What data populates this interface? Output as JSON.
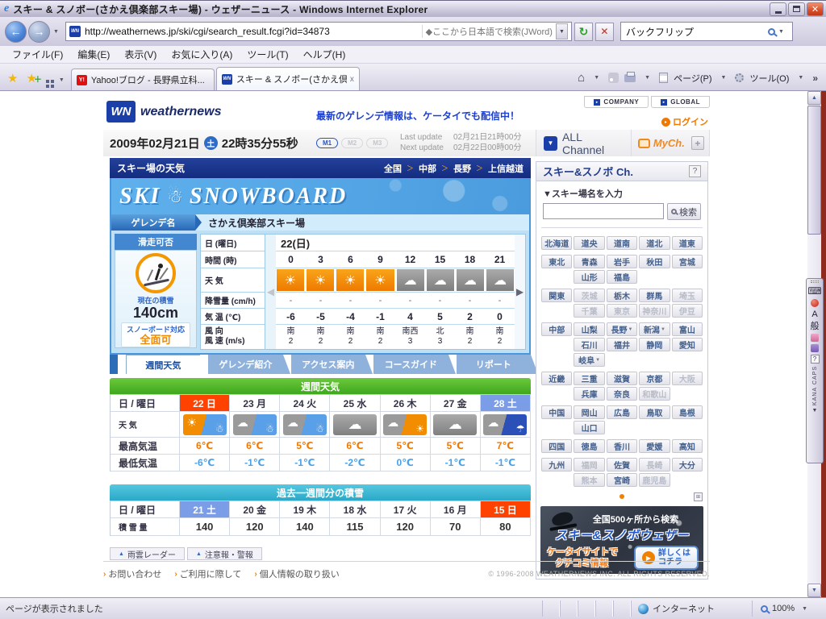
{
  "colors": {
    "accent_orange": "#F08A00",
    "accent_blue": "#2E6CC8",
    "navy": "#16309C",
    "holiday_red": "#FF4200",
    "saturday_blue": "#7B9DE8",
    "weekly_green": "#4FB82E",
    "past_cyan": "#3CB8DC"
  },
  "browser": {
    "title": "スキー & スノボー(さかえ倶楽部スキー場) - ウェザーニュース - Windows Internet Explorer",
    "url": "http://weathernews.jp/ski/cgi/search_result.fcgi?id=34873",
    "jword": "◆ここから日本語で検索(JWord)",
    "search_value": "バックフリップ",
    "menus": [
      "ファイル(F)",
      "編集(E)",
      "表示(V)",
      "お気に入り(A)",
      "ツール(T)",
      "ヘルプ(H)"
    ],
    "tabs": [
      {
        "label": "Yahoo!ブログ - 長野県立科...",
        "icon": "Y!"
      },
      {
        "label": "スキー & スノボー(さかえ倶...",
        "icon": "wn",
        "close": "x"
      }
    ],
    "command_bar": {
      "page": "ページ(P)",
      "tools": "ツール(O)",
      "overflow": "»"
    },
    "status": {
      "text": "ページが表示されました",
      "zone": "インターネット",
      "zoom": "100%"
    }
  },
  "header": {
    "logo_mark": "WN",
    "brand": "weathernews",
    "promo": "最新のゲレンデ情報は、ケータイでも配信中！",
    "company": "COMPANY",
    "global_label": "GLOBAL",
    "login": "ログイン",
    "date": "2009年02月21日",
    "dow": "土",
    "time": "22時35分55秒",
    "m_badges": [
      "M1",
      "M2",
      "M3"
    ],
    "last_update_label": "Last update",
    "last_update": "02月21日21時00分",
    "next_update_label": "Next update",
    "next_update": "02月22日00時00分",
    "all_channel": "ALL Channel",
    "mych": "MyCh.",
    "add_channel": "+"
  },
  "page": {
    "section_title": "スキー場の天気",
    "breadcrumb": [
      "全国",
      "中部",
      "長野",
      "上信越道"
    ],
    "breadcrumb_separator": "＞",
    "banner": {
      "ski": "SKI",
      "snowman": "☃",
      "snowboard": "SNOWBOARD"
    },
    "gelande_label": "ゲレンデ名",
    "gelande_name": "さかえ倶楽部スキー場",
    "status_card": {
      "title": "滑走可否",
      "snow_label": "現在の積雪",
      "snow_value": "140cm",
      "board_label": "スノーボード対応",
      "board_value": "全面可"
    },
    "icon_glyphs": {
      "sun": "☀",
      "cloud": "☁",
      "snow": "☃",
      "rain": "☂"
    },
    "hourly": {
      "date": "22(日)",
      "labels": {
        "day": "日 (曜日)",
        "hour": "時間 (時)",
        "weather": "天 気",
        "snowfall": "降雪量 (cm/h)",
        "temp": "気 温 (℃)",
        "wind_dir": "風 向",
        "wind_speed": "風 速 (m/s)"
      },
      "hours": [
        "0",
        "3",
        "6",
        "9",
        "12",
        "15",
        "18",
        "21"
      ],
      "icons": [
        "sun",
        "sun",
        "sun",
        "sun",
        "cloud",
        "cloud",
        "cloud",
        "cloud"
      ],
      "snowfall": [
        "-",
        "-",
        "-",
        "-",
        "-",
        "-",
        "-",
        "-"
      ],
      "temps": [
        "-6",
        "-5",
        "-4",
        "-1",
        "4",
        "5",
        "2",
        "0"
      ],
      "wind_dir": [
        "南",
        "南",
        "南",
        "南",
        "南西",
        "北",
        "南",
        "南"
      ],
      "wind_speed": [
        "2",
        "2",
        "2",
        "2",
        "3",
        "3",
        "2",
        "2"
      ]
    },
    "tabs": [
      "週間天気",
      "ゲレンデ紹介",
      "アクセス案内",
      "コースガイド",
      "リポート"
    ],
    "weekly": {
      "title": "週間天気",
      "labels": {
        "day": "日 / 曜日",
        "weather": "天 気",
        "high": "最高気温",
        "low": "最低気温"
      },
      "days": [
        {
          "label": "22 日",
          "style": "holiday"
        },
        {
          "label": "23 月"
        },
        {
          "label": "24 火"
        },
        {
          "label": "25 水"
        },
        {
          "label": "26 木"
        },
        {
          "label": "27 金"
        },
        {
          "label": "28 土",
          "style": "saturday"
        }
      ],
      "icons": [
        "sun-snow",
        "cloud-snow",
        "cloud-snow",
        "cloud",
        "cloud-sun",
        "cloud",
        "cloud-rain"
      ],
      "highs": [
        "6℃",
        "6℃",
        "5℃",
        "6℃",
        "5℃",
        "5℃",
        "7℃"
      ],
      "lows": [
        "-6℃",
        "-1℃",
        "-1℃",
        "-2℃",
        "0℃",
        "-1℃",
        "-1℃"
      ]
    },
    "past_week": {
      "title": "過去一週間分の積雪",
      "labels": {
        "day": "日 / 曜日",
        "amount": "積 雪 量"
      },
      "days": [
        {
          "label": "21 土",
          "style": "saturday"
        },
        {
          "label": "20 金"
        },
        {
          "label": "19 木"
        },
        {
          "label": "18 水"
        },
        {
          "label": "17 火"
        },
        {
          "label": "16 月"
        },
        {
          "label": "15 日",
          "style": "holiday"
        }
      ],
      "amounts": [
        "140",
        "120",
        "140",
        "115",
        "120",
        "70",
        "80"
      ]
    },
    "bottom_buttons": [
      "雨雲レーダー",
      "注意報・警報"
    ],
    "footer": {
      "link_bullet": "›",
      "links": [
        "お問い合わせ",
        "ご利用に際して",
        "個人情報の取り扱い"
      ],
      "copyright": "© 1996-2008 WEATHERNEWS INC. ALL RIGHTS RESERVED."
    }
  },
  "sidebar": {
    "title": "スキー&スノボ Ch.",
    "help": "?",
    "search_label": "▼スキー場名を入力",
    "search_button": "検索",
    "search_value": "",
    "regions": [
      {
        "gap": false,
        "cells": [
          {
            "t": "北海道"
          },
          {
            "t": "道央"
          },
          {
            "t": "道南"
          },
          {
            "t": "道北"
          },
          {
            "t": "道東"
          }
        ]
      },
      {
        "gap": true,
        "cells": [
          {
            "t": "東北"
          },
          {
            "t": "青森"
          },
          {
            "t": "岩手"
          },
          {
            "t": "秋田"
          },
          {
            "t": "宮城"
          }
        ]
      },
      {
        "gap": false,
        "cells": [
          {
            "s": "e"
          },
          {
            "t": "山形"
          },
          {
            "t": "福島"
          },
          {
            "s": "e"
          },
          {
            "s": "e"
          }
        ]
      },
      {
        "gap": true,
        "cells": [
          {
            "t": "関東"
          },
          {
            "t": "茨城",
            "s": "d"
          },
          {
            "t": "栃木"
          },
          {
            "t": "群馬"
          },
          {
            "t": "埼玉",
            "s": "d"
          }
        ]
      },
      {
        "gap": false,
        "cells": [
          {
            "s": "e"
          },
          {
            "t": "千葉",
            "s": "d"
          },
          {
            "t": "東京",
            "s": "d"
          },
          {
            "t": "神奈川",
            "s": "d"
          },
          {
            "t": "伊豆",
            "s": "d"
          }
        ]
      },
      {
        "gap": true,
        "cells": [
          {
            "t": "中部"
          },
          {
            "t": "山梨"
          },
          {
            "t": "長野",
            "a": true
          },
          {
            "t": "新潟",
            "a": true
          },
          {
            "t": "富山"
          }
        ]
      },
      {
        "gap": false,
        "cells": [
          {
            "s": "e"
          },
          {
            "t": "石川"
          },
          {
            "t": "福井"
          },
          {
            "t": "静岡"
          },
          {
            "t": "愛知"
          }
        ]
      },
      {
        "gap": false,
        "cells": [
          {
            "s": "e"
          },
          {
            "t": "岐阜",
            "a": true
          },
          {
            "s": "e"
          },
          {
            "s": "e"
          },
          {
            "s": "e"
          }
        ]
      },
      {
        "gap": true,
        "cells": [
          {
            "t": "近畿"
          },
          {
            "t": "三重"
          },
          {
            "t": "滋賀"
          },
          {
            "t": "京都"
          },
          {
            "t": "大阪",
            "s": "d"
          }
        ]
      },
      {
        "gap": false,
        "cells": [
          {
            "s": "e"
          },
          {
            "t": "兵庫"
          },
          {
            "t": "奈良"
          },
          {
            "t": "和歌山",
            "s": "d"
          },
          {
            "s": "e"
          }
        ]
      },
      {
        "gap": true,
        "cells": [
          {
            "t": "中国"
          },
          {
            "t": "岡山"
          },
          {
            "t": "広島"
          },
          {
            "t": "鳥取"
          },
          {
            "t": "島根"
          }
        ]
      },
      {
        "gap": false,
        "cells": [
          {
            "s": "e"
          },
          {
            "t": "山口"
          },
          {
            "s": "e"
          },
          {
            "s": "e"
          },
          {
            "s": "e"
          }
        ]
      },
      {
        "gap": true,
        "cells": [
          {
            "t": "四国"
          },
          {
            "t": "徳島"
          },
          {
            "t": "香川"
          },
          {
            "t": "愛媛"
          },
          {
            "t": "高知"
          }
        ]
      },
      {
        "gap": true,
        "cells": [
          {
            "t": "九州"
          },
          {
            "t": "福岡",
            "s": "d"
          },
          {
            "t": "佐賀"
          },
          {
            "t": "長崎",
            "s": "d"
          },
          {
            "t": "大分"
          }
        ]
      },
      {
        "gap": false,
        "cells": [
          {
            "s": "e"
          },
          {
            "t": "熊本",
            "s": "d"
          },
          {
            "t": "宮崎"
          },
          {
            "t": "鹿児島",
            "s": "d"
          },
          {
            "s": "e"
          }
        ]
      }
    ],
    "ad": {
      "line1": "全国500ヶ所から検索",
      "line2": "スキー&スノボウェザー",
      "line3": "ケータイサイトで",
      "line4": "クチコミ情報",
      "button_line1": "詳しくは",
      "button_line2": "コチラ"
    }
  },
  "ime": {
    "input_mode": "A",
    "conversion": "般",
    "caps": "CAPS",
    "kana": "KANA",
    "help": "?"
  }
}
